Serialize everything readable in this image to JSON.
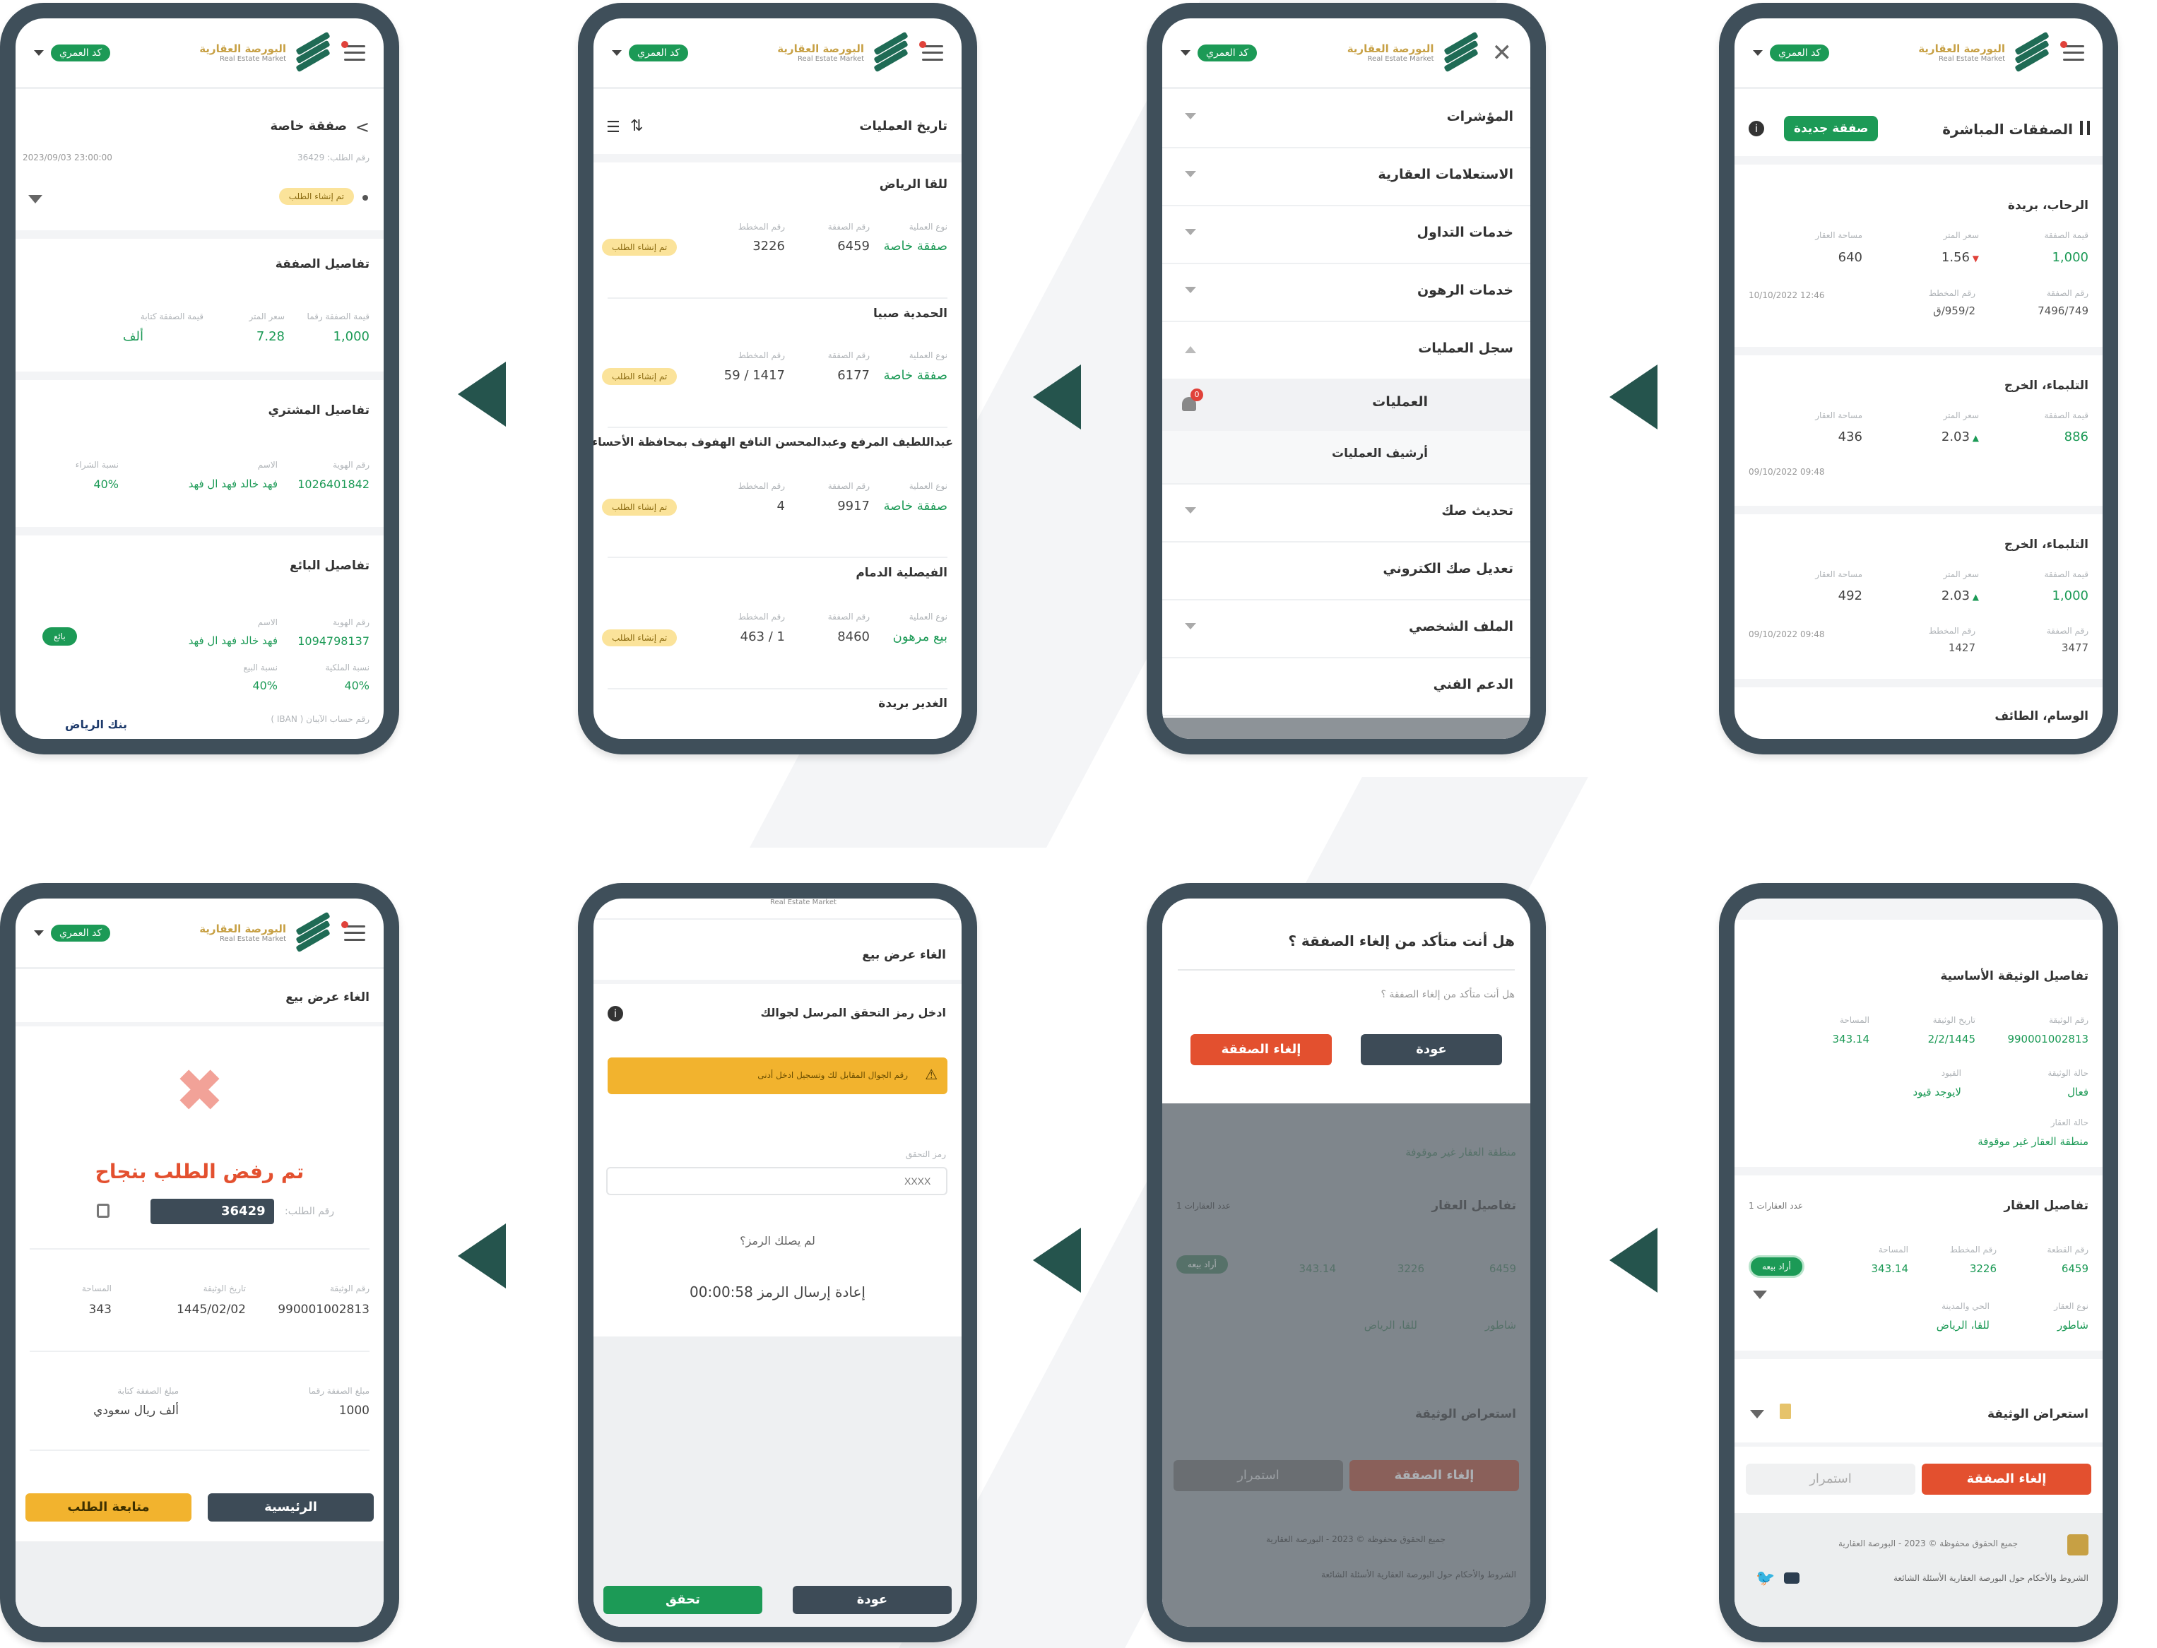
{
  "header": {
    "market_ar": "البورصة العقارية",
    "market_en": "Real Estate Market",
    "user_pill": "كد العمري"
  },
  "screens": {
    "live": {
      "title": "الصفقات المباشرة",
      "new_deal": "صفقة جديدة",
      "cards": [
        {
          "city": "الرحاب، بريدة",
          "l1": "قيمة الصفقة",
          "v1": "1,000",
          "l2": "سعر المتر",
          "v2": "1.56",
          "l3": "مساحة العقار",
          "v3": "640",
          "l4": "رقم الصفقة",
          "v4": "7496/749",
          "l5": "رقم المخطط",
          "v5": "959/2/ق",
          "date": "10/10/2022 12:46"
        },
        {
          "city": "التلبماء، الخرج",
          "l1": "قيمة الصفقة",
          "v1": "886",
          "l2": "سعر المتر",
          "v2": "2.03",
          "l3": "مساحة العقار",
          "v3": "436",
          "date": "09/10/2022 09:48"
        },
        {
          "city": "التلبماء، الخرج",
          "l1": "قيمة الصفقة",
          "v1": "1,000",
          "l2": "سعر المتر",
          "v2": "2.03",
          "l3": "مساحة العقار",
          "v3": "492",
          "l4": "رقم الصفقة",
          "v4": "3477",
          "l5": "رقم المخطط",
          "v5": "1427",
          "date": "09/10/2022 09:48"
        }
      ],
      "last_city": "الوسام، الطائف"
    },
    "menu": {
      "items": [
        "المؤشرات",
        "الاستعلامات العقارية",
        "خدمات التداول",
        "خدمات الرهون",
        "سجل العمليات",
        "العمليات",
        "أرشيف العمليات",
        "تحديث صك",
        "تعديل صك الكتروني",
        "الملف الشخصي",
        "الدعم الفني"
      ],
      "notif_count": "0"
    },
    "history": {
      "title": "تاريخ العمليات",
      "entries": [
        {
          "city": "للقا الرياض",
          "type": "صفقة خاصة",
          "num": "6459",
          "third": "3226",
          "status": "تم إنشاء الطلب"
        },
        {
          "city": "الحمدية صبيا",
          "type": "صفقة خاصة",
          "num": "6177",
          "third": "1417 / 59",
          "status": "تم إنشاء الطلب"
        },
        {
          "city": "عبداللطيف المرفع وعبدالمحسن النافع الهفوف بمحافظة الأحساء",
          "type": "صفقة خاصة",
          "num": "9917",
          "third": "4",
          "status": "تم إنشاء الطلب"
        },
        {
          "city": "الفيصلية الدمام",
          "type": "بيع مرهون",
          "num": "8460",
          "third": "1 / 463",
          "status": "تم إنشاء الطلب"
        }
      ],
      "last_city": "الغدير بريدة",
      "l_type": "نوع العملية",
      "l_num": "رقم الصفقة",
      "l_third": "رقم المخطط"
    },
    "deal": {
      "title": "صفقة خاصة",
      "status": "تم إنشاء الطلب",
      "date": "2023/09/03 23:00:00",
      "req_no_label": "رقم الطلب: 36429",
      "deal_details": "تفاصيل الصفقة",
      "dv1_l": "قيمة الصفقة رقما",
      "dv1": "1,000",
      "dv2_l": "سعر المتر",
      "dv2": "7.28",
      "dv3_l": "قيمة الصفقة كتابة",
      "dv3": "ألف",
      "buyer": "تفاصيل المشتري",
      "b_id_l": "رقم الهوية",
      "b_id": "1026401842",
      "b_name_l": "الاسم",
      "b_name": "فهد خالد فهد ال فهد",
      "b_pct_l": "نسبة الشراء",
      "b_pct": "40%",
      "seller": "تفاصيل البائع",
      "s_id_l": "رقم الهوية",
      "s_id": "1094798137",
      "s_name_l": "الاسم",
      "s_name": "فهد خالد فهد ال فهد",
      "s_tag": "بائع",
      "s_own_l": "نسبة الملكية",
      "s_own": "40%",
      "s_sale_l": "نسبة البيع",
      "s_sale": "40%",
      "iban_l": "رقم حساب الآيبان ( IBAN )",
      "bank": "بنك الرياض"
    },
    "doc": {
      "doc_title": "تفاصيل الوثيقة الأساسية",
      "doc_no_l": "رقم الوثيقة",
      "doc_no": "990001002813",
      "doc_date_l": "تاريخ الوثيقة",
      "doc_date": "2/2/1445",
      "area_l": "المساحة",
      "area": "343.14",
      "state_l": "حالة الوثيقة",
      "state": "فعال",
      "restr_l": "القيود",
      "restr": "لايوجد قيود",
      "prop_state_l": "حالة العقار",
      "prop_state": "منطقة العقار غير موقوفة",
      "prop_title": "تفاصيل العقار",
      "prop_count": "عدد العقارات 1",
      "p_no_l": "رقم القطعة",
      "p_no": "6459",
      "p_plan_l": "رقم المخطط",
      "p_plan": "3226",
      "p_area_l": "المساحة",
      "p_area": "343.14",
      "p_type_l": "نوع العقار",
      "p_type": "شاطور",
      "p_dist_l": "الحي والمدينة",
      "p_dist": "للقا، الرياض",
      "tag": "أراد بيعه",
      "view_doc": "استعراض الوثيقة",
      "cancel": "إلغاء الصفقة",
      "continue": "استمرار",
      "footer": "جميع الحقوق محفوظة © 2023 - البورصة العقارية",
      "footer_links": "الشروط والأحكام  حول البورصة العقارية  الأسئلة الشائعة"
    },
    "confirm": {
      "q": "هل أنت متأكد من إلغاء الصفقة ؟",
      "sub": "هل أنت متأكد من إلغاء الصفقة ؟",
      "yes": "إلغاء الصفقة",
      "back": "عودة"
    },
    "otp": {
      "title": "الغاء عرض بيع",
      "prompt": "ادخل رمز التحقق المرسل لجوالك",
      "warn": "رقم الجوال المقابل لك وتسجيل ادخل أدنى",
      "label": "رمز التحقق",
      "placeholder": "XXXX",
      "no_code": "لم يصلك الرمز؟",
      "resend": "إعادة إرسال الرمز 00:00:58",
      "verify": "تحقق",
      "back": "عودة"
    },
    "result": {
      "title": "الغاء عرض بيع",
      "msg": "تم رفض الطلب بنجاح",
      "req_l": "رقم الطلب:",
      "req": "36429",
      "doc_no_l": "رقم الوثيقة",
      "doc_no": "990001002813",
      "doc_date_l": "تاريخ الوثيقة",
      "doc_date": "1445/02/02",
      "area_l": "المساحة",
      "area": "343",
      "amt_l": "مبلغ الصفقة رقما",
      "amt": "1000",
      "amt_txt_l": "مبلغ الصفقة كتابة",
      "amt_txt": "ألف ريال سعودي",
      "home": "الرئيسية",
      "track": "متابعة الطلب"
    }
  },
  "colors": {
    "frame": "#3f4f5a",
    "arrow": "#25544d",
    "green": "#1c9a56",
    "red": "#e3502f",
    "amber": "#f2b32e",
    "dark": "#3d4b57"
  }
}
